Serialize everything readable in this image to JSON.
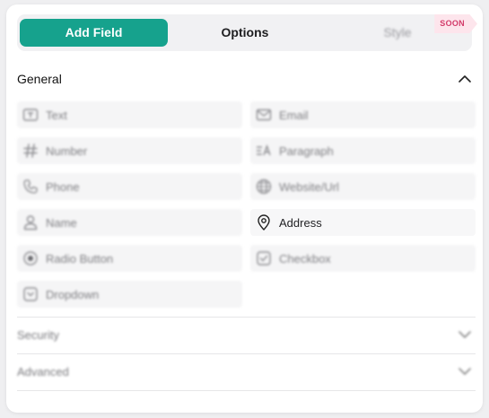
{
  "tabs": [
    {
      "label": "Add Field",
      "active": true
    },
    {
      "label": "Options",
      "active": false
    },
    {
      "label": "Style",
      "active": false,
      "badge": "SOON"
    }
  ],
  "sections": {
    "general": {
      "title": "General",
      "expanded": true
    },
    "security": {
      "title": "Security",
      "expanded": false
    },
    "advanced": {
      "title": "Advanced",
      "expanded": false
    }
  },
  "fields": [
    {
      "label": "Text",
      "icon": "text-icon"
    },
    {
      "label": "Email",
      "icon": "envelope-icon"
    },
    {
      "label": "Number",
      "icon": "hash-icon"
    },
    {
      "label": "Paragraph",
      "icon": "paragraph-icon"
    },
    {
      "label": "Phone",
      "icon": "phone-icon"
    },
    {
      "label": "Website/Url",
      "icon": "globe-icon"
    },
    {
      "label": "Name",
      "icon": "user-icon"
    },
    {
      "label": "Address",
      "icon": "location-pin-icon"
    },
    {
      "label": "Radio Button",
      "icon": "radio-icon"
    },
    {
      "label": "Checkbox",
      "icon": "checkbox-icon"
    },
    {
      "label": "Dropdown",
      "icon": "dropdown-icon"
    }
  ],
  "colors": {
    "accent": "#16a28d",
    "badge_bg": "#fde5ec",
    "badge_text": "#d33b6a"
  }
}
